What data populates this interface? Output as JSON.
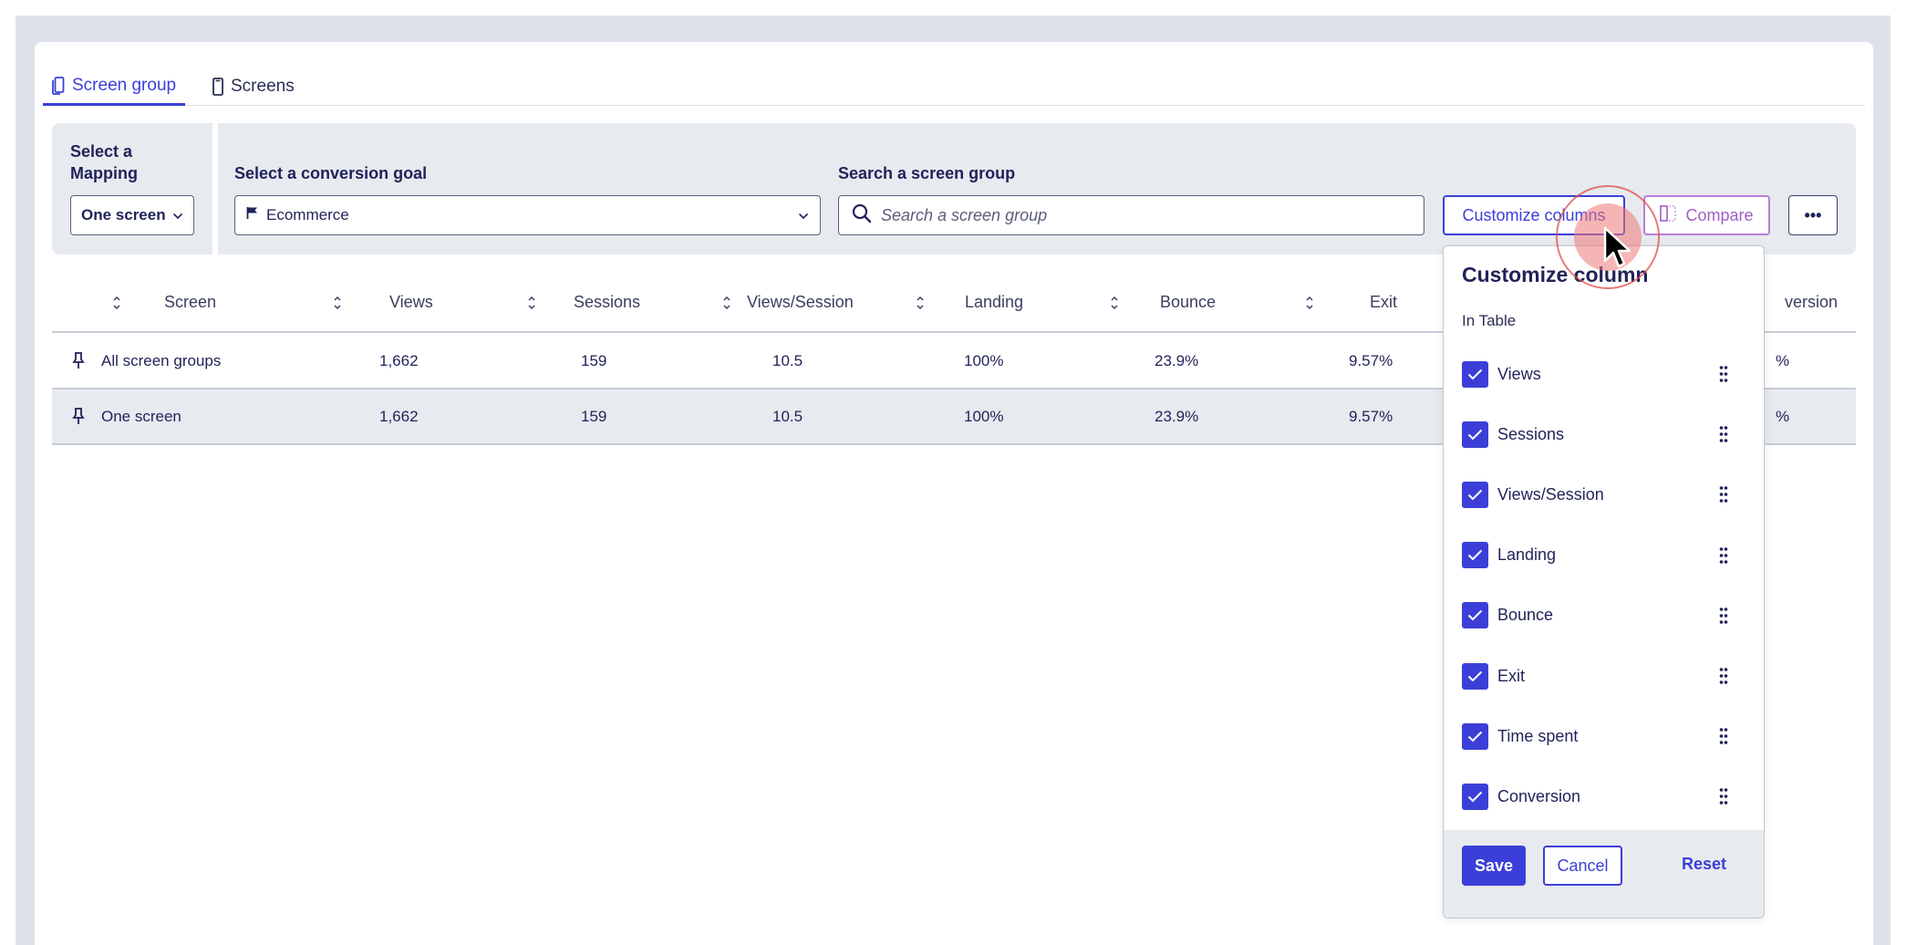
{
  "tabs": [
    {
      "label": "Screen group",
      "active": true,
      "icon": "screen-group-icon"
    },
    {
      "label": "Screens",
      "active": false,
      "icon": "phone-icon"
    }
  ],
  "filters": {
    "mapping_label": "Select a\nMapping",
    "mapping_value": "One screen",
    "goal_label": "Select a conversion goal",
    "goal_value": "Ecommerce",
    "search_label": "Search a screen group",
    "search_placeholder": "Search a screen group"
  },
  "toolbar": {
    "customize_label": "Customize columns",
    "compare_label": "Compare",
    "more_label": "•••"
  },
  "table": {
    "columns": [
      "Screen",
      "Views",
      "Sessions",
      "Views/Session",
      "Landing",
      "Bounce",
      "Exit",
      "Time spent",
      "Conversion"
    ],
    "visible_header_fragments": {
      "conversion": "version"
    },
    "rows": [
      {
        "screen": "All screen groups",
        "views": "1,662",
        "sessions": "159",
        "views_session": "10.5",
        "landing": "100%",
        "bounce": "23.9%",
        "exit": "9.57%",
        "conversion_fragment": "%"
      },
      {
        "screen": "One screen",
        "views": "1,662",
        "sessions": "159",
        "views_session": "10.5",
        "landing": "100%",
        "bounce": "23.9%",
        "exit": "9.57%",
        "conversion_fragment": "%"
      }
    ]
  },
  "customize_popover": {
    "title": "Customize column",
    "subtitle": "In Table",
    "options": [
      {
        "label": "Views",
        "checked": true
      },
      {
        "label": "Sessions",
        "checked": true
      },
      {
        "label": "Views/Session",
        "checked": true
      },
      {
        "label": "Landing",
        "checked": true
      },
      {
        "label": "Bounce",
        "checked": true
      },
      {
        "label": "Exit",
        "checked": true
      },
      {
        "label": "Time spent",
        "checked": true
      },
      {
        "label": "Conversion",
        "checked": true
      }
    ],
    "save_label": "Save",
    "cancel_label": "Cancel",
    "reset_label": "Reset"
  },
  "colors": {
    "accent": "#3b3fd8",
    "compare": "#9f5fc6",
    "text": "#1f2358",
    "panel": "#e7eaef"
  }
}
